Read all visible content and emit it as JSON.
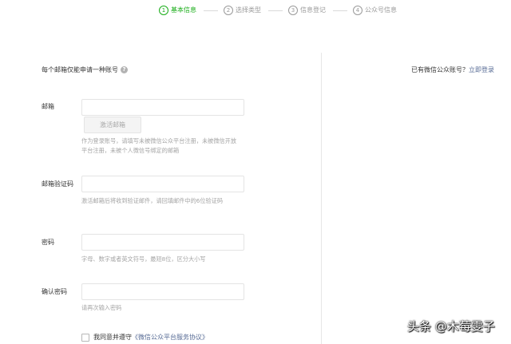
{
  "steps": [
    {
      "number": "1",
      "label": "基本信息",
      "active": true
    },
    {
      "number": "2",
      "label": "选择类型",
      "active": false
    },
    {
      "number": "3",
      "label": "信息登记",
      "active": false
    },
    {
      "number": "4",
      "label": "公众号信息",
      "active": false
    }
  ],
  "colors": {
    "accent": "#1aad19",
    "link": "#576b95"
  },
  "note": {
    "text": "每个邮箱仅能申请一种账号",
    "icon": "help-icon"
  },
  "login_hint": {
    "text": "已有微信公众账号？",
    "link": "立即登录"
  },
  "form": {
    "email": {
      "label": "邮箱",
      "value": "",
      "activate_button": "激活邮箱",
      "tip": "作为登录账号，请填写未被微信公众平台注册，未被微信开放平台注册，未被个人微信号绑定的邮箱"
    },
    "code": {
      "label": "邮箱验证码",
      "value": "",
      "tip": "激活邮箱后将收到验证邮件，请回填邮件中的6位验证码"
    },
    "password": {
      "label": "密码",
      "value": "",
      "tip": "字母、数字或者英文符号，最短8位，区分大小写"
    },
    "confirm": {
      "label": "确认密码",
      "value": "",
      "tip": "请再次输入密码"
    }
  },
  "agreement": {
    "text": "我同意并遵守",
    "link": "《微信公众平台服务协议》",
    "checked": false
  },
  "watermark": "头条 @木莓雯子"
}
